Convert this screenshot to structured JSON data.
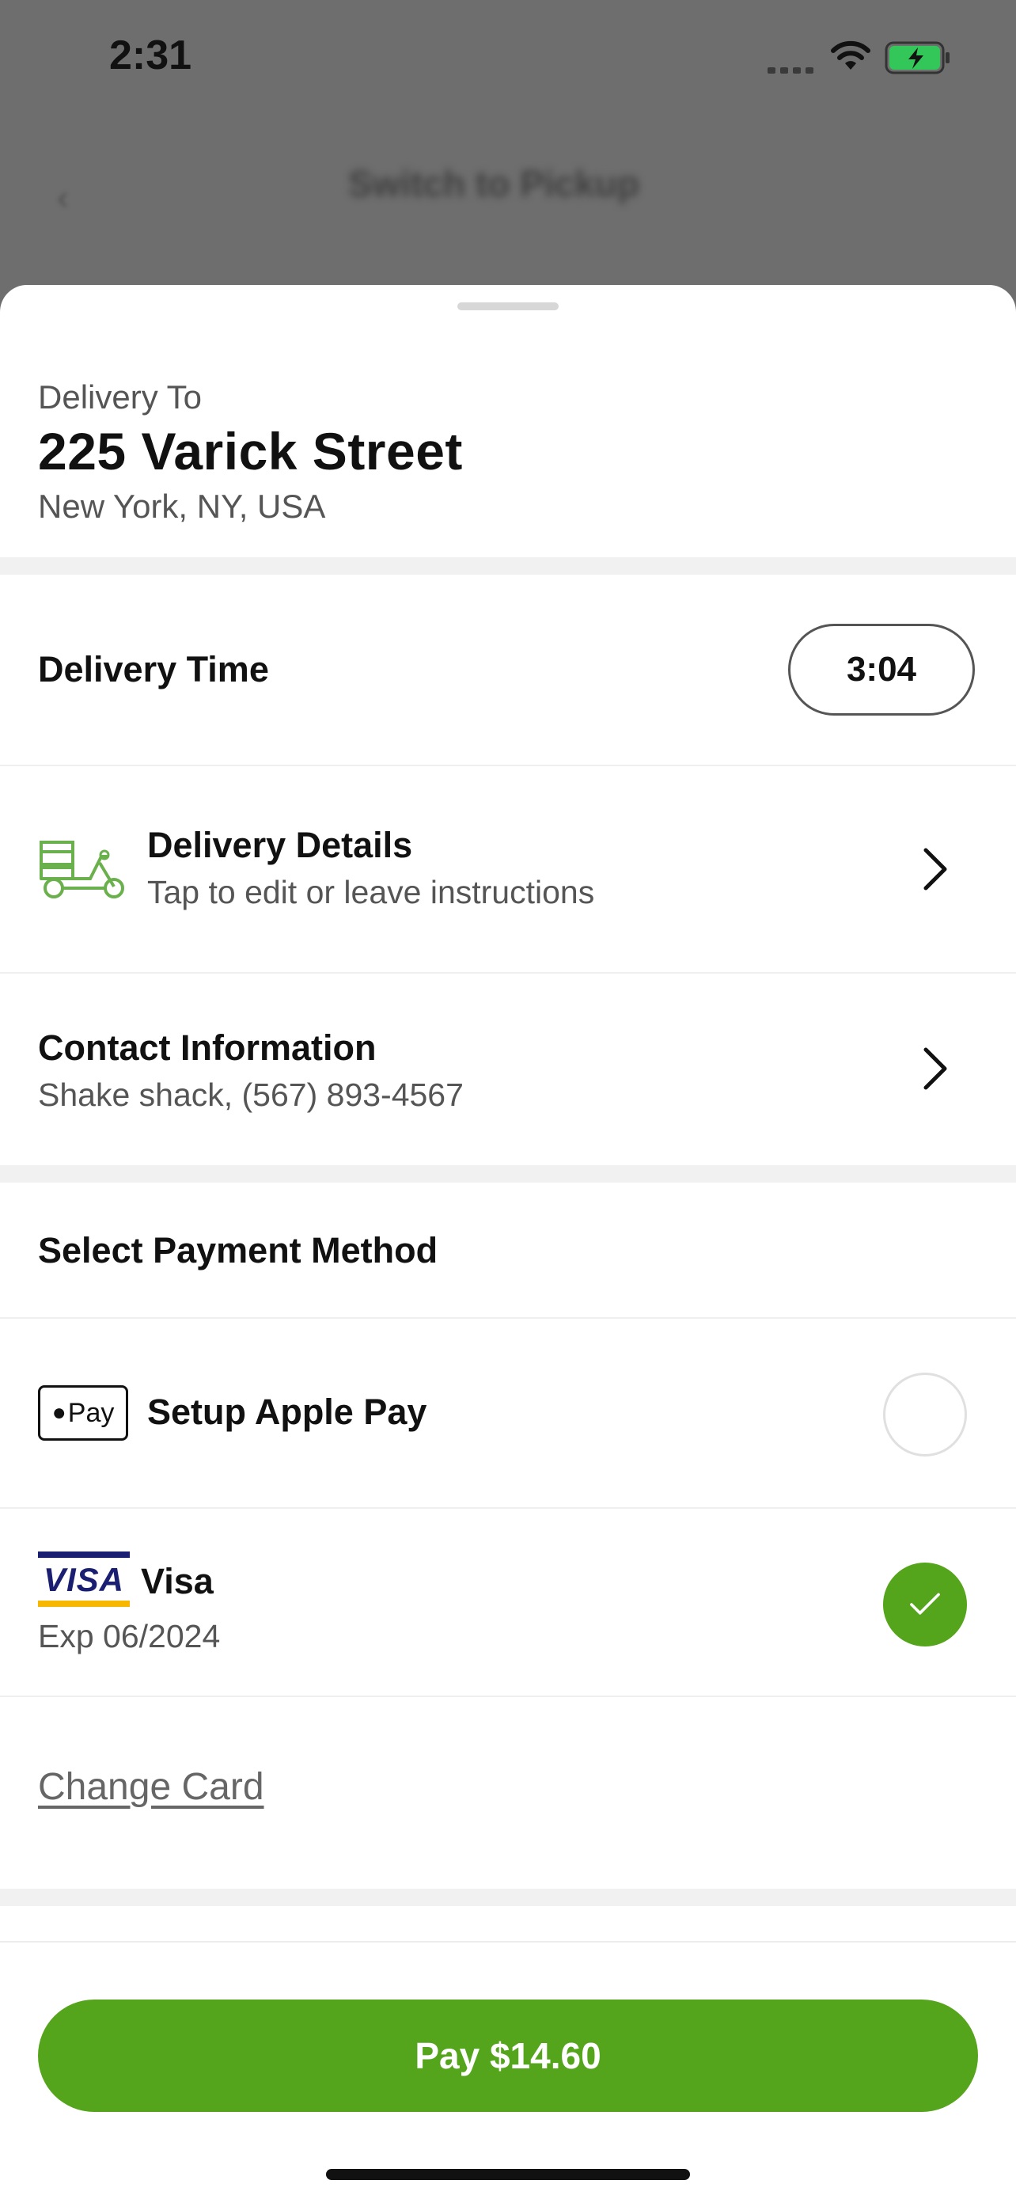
{
  "status_bar": {
    "time": "2:31"
  },
  "background_page": {
    "title": "Switch to Pickup"
  },
  "delivery_address": {
    "label": "Delivery To",
    "street": "225 Varick Street",
    "city": "New York, NY, USA"
  },
  "delivery_time": {
    "label": "Delivery Time",
    "value": "3:04"
  },
  "delivery_details": {
    "title": "Delivery Details",
    "subtitle": "Tap to edit or leave instructions"
  },
  "contact_information": {
    "title": "Contact Information",
    "subtitle": "Shake shack, (567) 893-4567"
  },
  "payment": {
    "section_title": "Select Payment Method",
    "apple_pay": {
      "badge": "Pay",
      "label": "Setup Apple Pay",
      "selected": false
    },
    "visa": {
      "logo": "VISA",
      "label": "Visa",
      "expiry": "Exp 06/2024",
      "selected": true
    },
    "change_card": "Change Card"
  },
  "pay_button": "Pay $14.60",
  "colors": {
    "accent": "#55a51c",
    "text": "#111111",
    "muted": "#555555"
  },
  "icons": [
    "back-icon",
    "wifi-icon",
    "battery-icon",
    "scooter-icon",
    "chevron-right-icon",
    "apple-logo-icon",
    "checkmark-icon"
  ]
}
